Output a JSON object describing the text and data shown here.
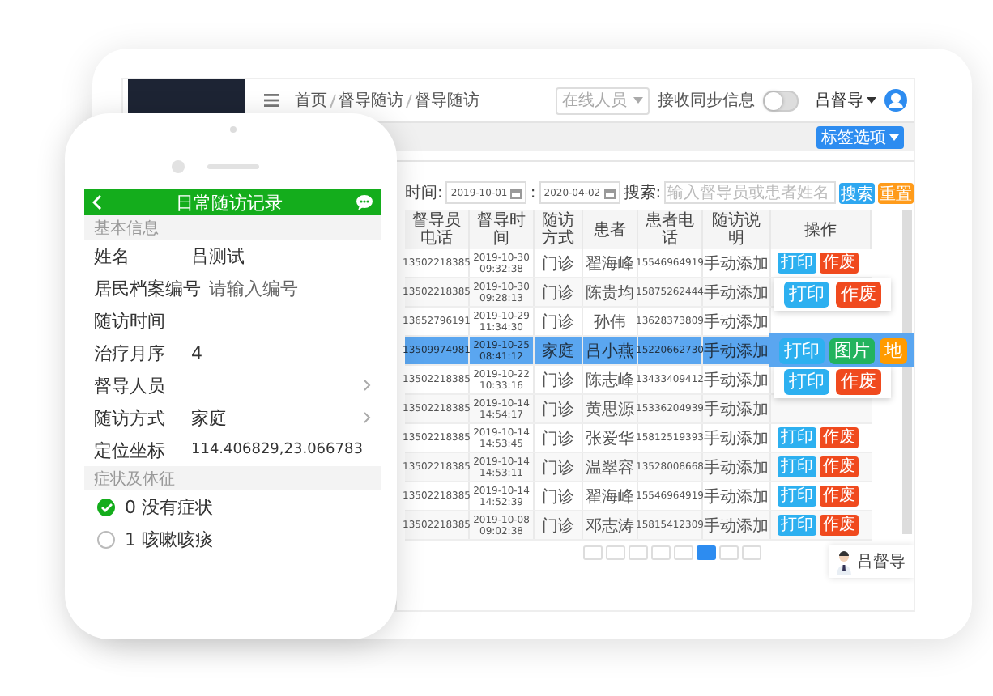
{
  "tablet": {
    "breadcrumb": [
      "首页",
      "督导随访",
      "督导随访"
    ],
    "online_select": {
      "placeholder": "在线人员"
    },
    "sync_toggle": {
      "label": "接收同步信息",
      "on": false
    },
    "user": {
      "name": "吕督导"
    },
    "tag_button": "标签选项",
    "filters": {
      "time_label": "时间:",
      "start_date": "2019-10-01",
      "separator": ":",
      "end_date": "2020-04-02",
      "search_label": "搜索:",
      "search": {
        "placeholder": "输入督导员或患者姓名"
      },
      "buttons": [
        {
          "label": "搜索",
          "kind": "primary"
        },
        {
          "label": "重置",
          "kind": "warning"
        }
      ]
    },
    "table": {
      "columns": [
        {
          "label": "督导员电话",
          "kind": "number"
        },
        {
          "label": "督导时间",
          "kind": "number"
        },
        {
          "label": "随访方式",
          "kind": "text"
        },
        {
          "label": "患者",
          "kind": "text"
        },
        {
          "label": "患者电话",
          "kind": "number"
        },
        {
          "label": "随访说明",
          "kind": "text"
        },
        {
          "label": "操作",
          "kind": "actions"
        }
      ],
      "rows": [
        {
          "cells": [
            "13502218385",
            "2019-10-30 09:32:38",
            "门诊",
            "翟海峰",
            "15546964919",
            "手动添加"
          ],
          "selected": false,
          "expanded": false,
          "actions": [
            {
              "label": "打印",
              "kind": "print"
            },
            {
              "label": "作废",
              "kind": "void"
            }
          ]
        },
        {
          "cells": [
            "13502218385",
            "2019-10-30 09:28:13",
            "门诊",
            "陈贵均",
            "15875262444",
            "手动添加"
          ],
          "selected": false,
          "expanded": true,
          "actions": [
            {
              "label": "打印",
              "kind": "print"
            },
            {
              "label": "作废",
              "kind": "void"
            }
          ]
        },
        {
          "cells": [
            "13652796191",
            "2019-10-29 11:34:30",
            "门诊",
            "孙伟",
            "13628373809",
            "手动添加"
          ],
          "selected": false,
          "expanded": false,
          "actions": []
        },
        {
          "cells": [
            "13509974981",
            "2019-10-25 08:41:12",
            "家庭",
            "吕小燕",
            "15220662730",
            "手动添加"
          ],
          "selected": true,
          "expanded": true,
          "actions": [
            {
              "label": "打印",
              "kind": "print"
            },
            {
              "label": "图片",
              "kind": "picture"
            },
            {
              "label": "地",
              "kind": "map"
            }
          ]
        },
        {
          "cells": [
            "13502218385",
            "2019-10-22 10:33:16",
            "门诊",
            "陈志峰",
            "13433409412",
            "手动添加"
          ],
          "selected": false,
          "expanded": true,
          "actions": [
            {
              "label": "打印",
              "kind": "print"
            },
            {
              "label": "作废",
              "kind": "void"
            }
          ]
        },
        {
          "cells": [
            "13502218385",
            "2019-10-14 14:54:17",
            "门诊",
            "黄思源",
            "15336204939",
            "手动添加"
          ],
          "selected": false,
          "expanded": false,
          "actions": []
        },
        {
          "cells": [
            "13502218385",
            "2019-10-14 14:53:45",
            "门诊",
            "张爱华",
            "15812519393",
            "手动添加"
          ],
          "selected": false,
          "expanded": false,
          "actions": [
            {
              "label": "打印",
              "kind": "print"
            },
            {
              "label": "作废",
              "kind": "void"
            }
          ]
        },
        {
          "cells": [
            "13502218385",
            "2019-10-14 14:53:11",
            "门诊",
            "温翠容",
            "13528008668",
            "手动添加"
          ],
          "selected": false,
          "expanded": false,
          "actions": [
            {
              "label": "打印",
              "kind": "print"
            },
            {
              "label": "作废",
              "kind": "void"
            }
          ]
        },
        {
          "cells": [
            "13502218385",
            "2019-10-14 14:52:39",
            "门诊",
            "翟海峰",
            "15546964919",
            "手动添加"
          ],
          "selected": false,
          "expanded": false,
          "actions": [
            {
              "label": "打印",
              "kind": "print"
            },
            {
              "label": "作废",
              "kind": "void"
            }
          ]
        },
        {
          "cells": [
            "13502218385",
            "2019-10-08 09:02:38",
            "门诊",
            "邓志涛",
            "15815412309",
            "手动添加"
          ],
          "selected": false,
          "expanded": false,
          "actions": [
            {
              "label": "打印",
              "kind": "print"
            },
            {
              "label": "作废",
              "kind": "void"
            }
          ]
        }
      ]
    },
    "floating_user": {
      "name": "吕督导"
    }
  },
  "phone": {
    "title": "日常随访记录",
    "sections": [
      {
        "title": "基本信息",
        "fields": [
          {
            "label": "姓名",
            "value": "吕测试",
            "kind": "text"
          },
          {
            "label": "居民档案编号",
            "placeholder": "请输入编号",
            "kind": "input"
          },
          {
            "label": "随访时间",
            "kind": "text"
          },
          {
            "label": "治疗月序",
            "value": "4",
            "kind": "text"
          },
          {
            "label": "督导人员",
            "kind": "select"
          },
          {
            "label": "随访方式",
            "value": "家庭",
            "kind": "select"
          },
          {
            "label": "定位坐标",
            "value": "114.406829,23.066783",
            "kind": "text"
          }
        ]
      },
      {
        "title": "症状及体征",
        "options": [
          {
            "label": "0 没有症状",
            "checked": true
          },
          {
            "label": "1 咳嗽咳痰",
            "checked": false
          }
        ]
      }
    ]
  }
}
